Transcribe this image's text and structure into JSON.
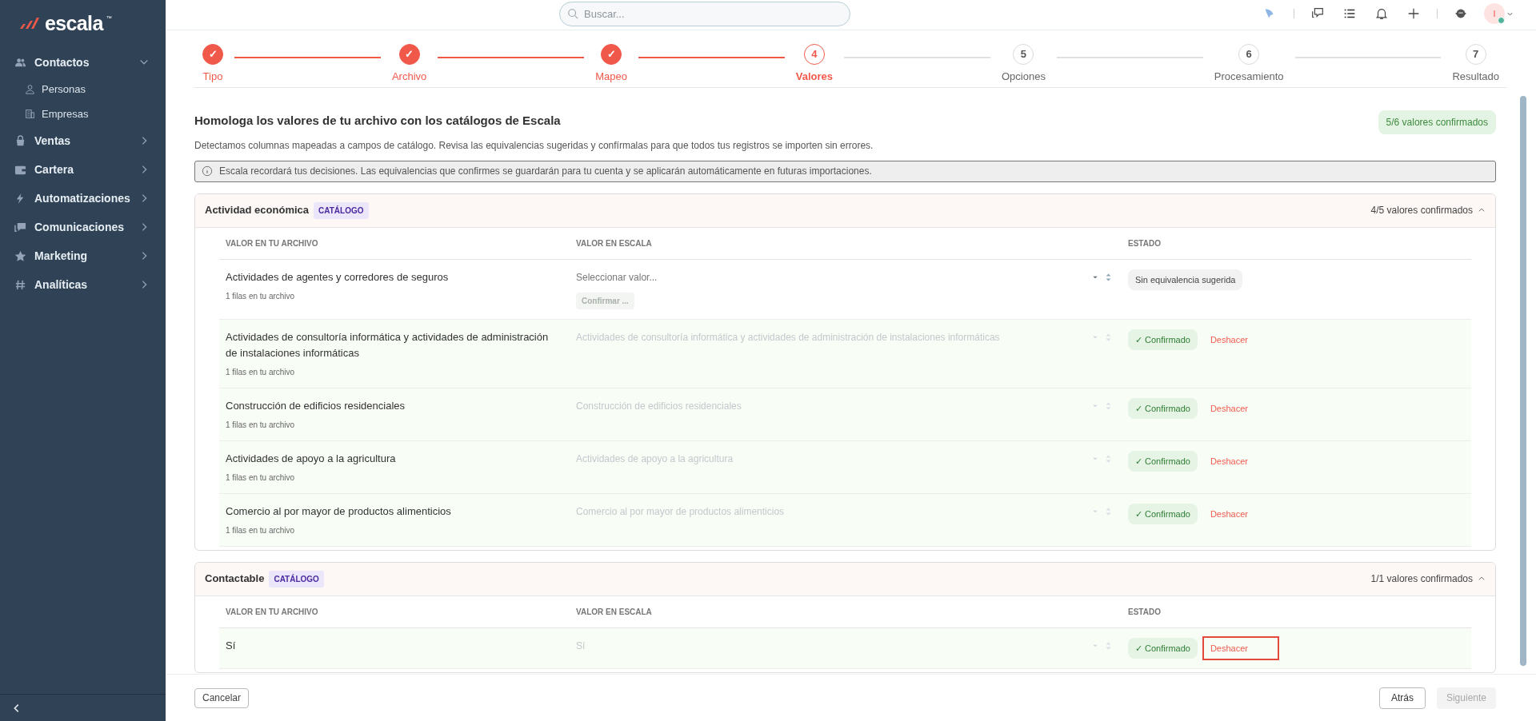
{
  "brand": {
    "name": "escala",
    "tm": "™"
  },
  "sidebar": {
    "items": [
      {
        "label": "Contactos",
        "expanded": true,
        "children": [
          {
            "label": "Personas"
          },
          {
            "label": "Empresas"
          }
        ]
      },
      {
        "label": "Ventas",
        "expanded": false
      },
      {
        "label": "Cartera",
        "expanded": false
      },
      {
        "label": "Automatizaciones",
        "expanded": false
      },
      {
        "label": "Comunicaciones",
        "expanded": false
      },
      {
        "label": "Marketing",
        "expanded": false
      },
      {
        "label": "Analíticas",
        "expanded": false
      }
    ]
  },
  "search": {
    "placeholder": "Buscar..."
  },
  "user": {
    "initial": "I"
  },
  "steps": [
    {
      "number": "✓",
      "label": "Tipo",
      "completed": true,
      "selected": false
    },
    {
      "number": "✓",
      "label": "Archivo",
      "completed": true,
      "selected": false
    },
    {
      "number": "✓",
      "label": "Mapeo",
      "completed": true,
      "selected": false
    },
    {
      "number": "4",
      "label": "Valores",
      "completed": false,
      "selected": true
    },
    {
      "number": "5",
      "label": "Opciones",
      "completed": false,
      "selected": false
    },
    {
      "number": "6",
      "label": "Procesamiento",
      "completed": false,
      "selected": false
    },
    {
      "number": "7",
      "label": "Resultado",
      "completed": false,
      "selected": false
    }
  ],
  "header": {
    "title": "Homologa los valores de tu archivo con los catálogos de Escala",
    "subtitle": "Detectamos columnas mapeadas a campos de catálogo. Revisa las equivalencias sugeridas y confírmalas para que todos tus registros se importen sin errores.",
    "summary": "5/6 valores confirmados"
  },
  "notice": "Escala recordará tus decisiones. Las equivalencias que confirmes se guardarán para tu cuenta y se aplicarán automáticamente en futuras importaciones.",
  "sections": [
    {
      "title": "Actividad económica",
      "tag": "CATÁLOGO",
      "summary": "4/5 valores confirmados",
      "expanded": true,
      "columns": [
        "VALOR EN TU ARCHIVO",
        "VALOR EN ESCALA",
        "ESTADO"
      ],
      "rows": [
        {
          "file_value": "Actividades de agentes y corredores de seguros",
          "count": "1 filas en tu archivo",
          "placeholder": "Seleccionar valor...",
          "confirm_button": "Confirmar ...",
          "status": "Sin equivalencia sugerida",
          "confirmed": false
        },
        {
          "file_value": "Actividades de consultoría informática y actividades de administración de instalaciones informáticas",
          "count": "1 filas en tu archivo",
          "scale_value": "Actividades de consultoría informática y actividades de administración de instalaciones informáticas",
          "status": "✓ Confirmado",
          "action": "Deshacer",
          "confirmed": true,
          "highlighted": false
        },
        {
          "file_value": "Construcción de edificios residenciales",
          "count": "1 filas en tu archivo",
          "scale_value": "Construcción de edificios residenciales",
          "status": "✓ Confirmado",
          "action": "Deshacer",
          "confirmed": true,
          "highlighted": false
        },
        {
          "file_value": "Actividades de apoyo a la agricultura",
          "count": "1 filas en tu archivo",
          "scale_value": "Actividades de apoyo a la agricultura",
          "status": "✓ Confirmado",
          "action": "Deshacer",
          "confirmed": true,
          "highlighted": false
        },
        {
          "file_value": "Comercio al por mayor de productos alimenticios",
          "count": "1 filas en tu archivo",
          "scale_value": "Comercio al por mayor de productos alimenticios",
          "status": "✓ Confirmado",
          "action": "Deshacer",
          "confirmed": true,
          "highlighted": false
        }
      ]
    },
    {
      "title": "Contactable",
      "tag": "CATÁLOGO",
      "summary": "1/1 valores confirmados",
      "expanded": true,
      "columns": [
        "VALOR EN TU ARCHIVO",
        "VALOR EN ESCALA",
        "ESTADO"
      ],
      "rows": [
        {
          "file_value": "Sí",
          "scale_value": "Sí",
          "status": "✓ Confirmado",
          "action": "Deshacer",
          "confirmed": true,
          "highlighted": true
        }
      ]
    }
  ],
  "footer": {
    "cancel": "Cancelar",
    "back": "Atrás",
    "next": "Siguiente",
    "next_disabled": true
  }
}
